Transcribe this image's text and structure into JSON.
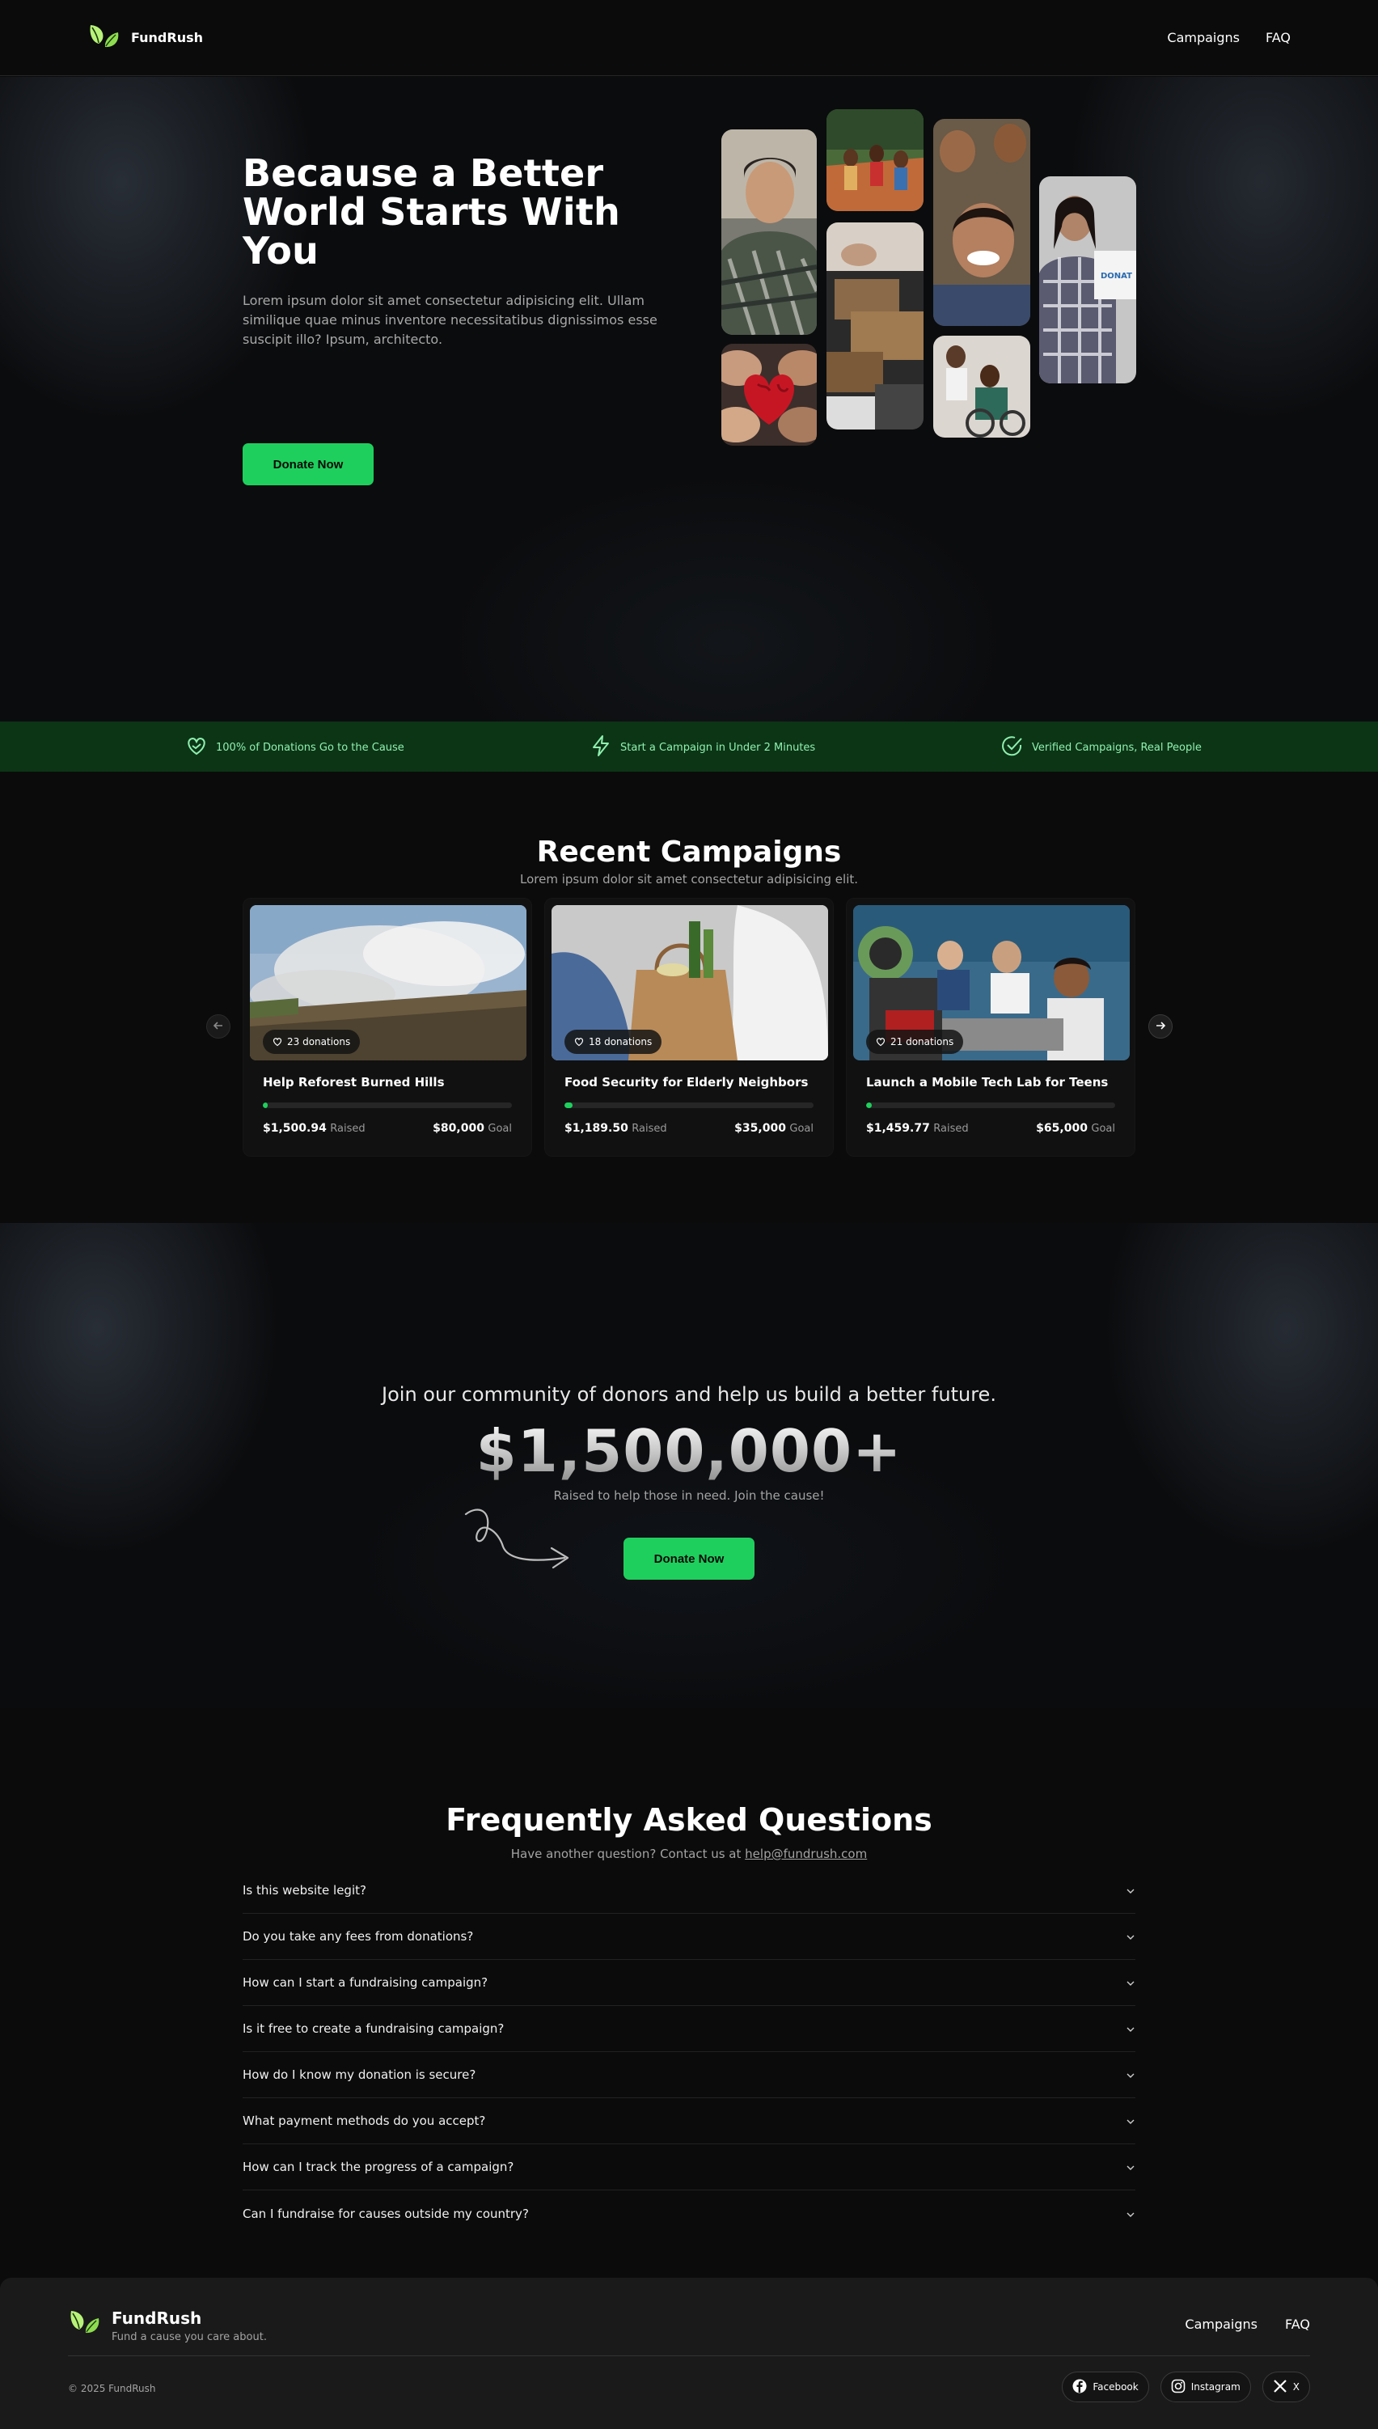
{
  "nav": {
    "brand": "FundRush",
    "links": [
      "Campaigns",
      "FAQ"
    ]
  },
  "hero": {
    "title": "Because a Better World Starts With You",
    "subtitle": "Lorem ipsum dolor sit amet consectetur adipisicing elit. Ullam similique quae minus inventore necessitatibus dignissimos esse suscipit illo? Ipsum, architecto.",
    "cta": "Donate Now"
  },
  "features": [
    {
      "icon": "heart-hand-icon",
      "label": "100% of Donations Go to the Cause"
    },
    {
      "icon": "lightning-icon",
      "label": "Start a Campaign in Under 2 Minutes"
    },
    {
      "icon": "check-circle-icon",
      "label": "Verified Campaigns, Real People"
    }
  ],
  "campaigns": {
    "title": "Recent Campaigns",
    "subtitle": "Lorem ipsum dolor sit amet consectetur adipisicing elit.",
    "items": [
      {
        "title": "Help Reforest Burned Hills",
        "donations": "23 donations",
        "raised": "$1,500.94",
        "raised_label": "Raised",
        "goal": "$80,000",
        "goal_label": "Goal",
        "progress": 0.019
      },
      {
        "title": "Food Security for Elderly Neighbors",
        "donations": "18 donations",
        "raised": "$1,189.50",
        "raised_label": "Raised",
        "goal": "$35,000",
        "goal_label": "Goal",
        "progress": 0.034
      },
      {
        "title": "Launch a Mobile Tech Lab for Teens",
        "donations": "21 donations",
        "raised": "$1,459.77",
        "raised_label": "Raised",
        "goal": "$65,000",
        "goal_label": "Goal",
        "progress": 0.022
      }
    ]
  },
  "community": {
    "heading": "Join our community of donors and help us build a better future.",
    "amount": "$1,500,000+",
    "subtitle": "Raised to help those in need. Join the cause!",
    "cta": "Donate Now"
  },
  "faq": {
    "title": "Frequently Asked Questions",
    "subtitle_prefix": "Have another question? Contact us at",
    "email": "help@fundrush.com",
    "questions": [
      "Is this website legit?",
      "Do you take any fees from donations?",
      "How can I start a fundraising campaign?",
      "Is it free to create a fundraising campaign?",
      "How do I know my donation is secure?",
      "What payment methods do you accept?",
      "How can I track the progress of a campaign?",
      "Can I fundraise for causes outside my country?"
    ]
  },
  "footer": {
    "brand": "FundRush",
    "tagline": "Fund a cause you care about.",
    "links": [
      "Campaigns",
      "FAQ"
    ],
    "copyright": "© 2025 FundRush",
    "socials": [
      "Facebook",
      "Instagram",
      "X"
    ]
  },
  "colors": {
    "accent": "#1fcf5d",
    "strip_bg": "#0c3516",
    "strip_text": "#8ff0ae",
    "background": "#0b0b0b"
  }
}
